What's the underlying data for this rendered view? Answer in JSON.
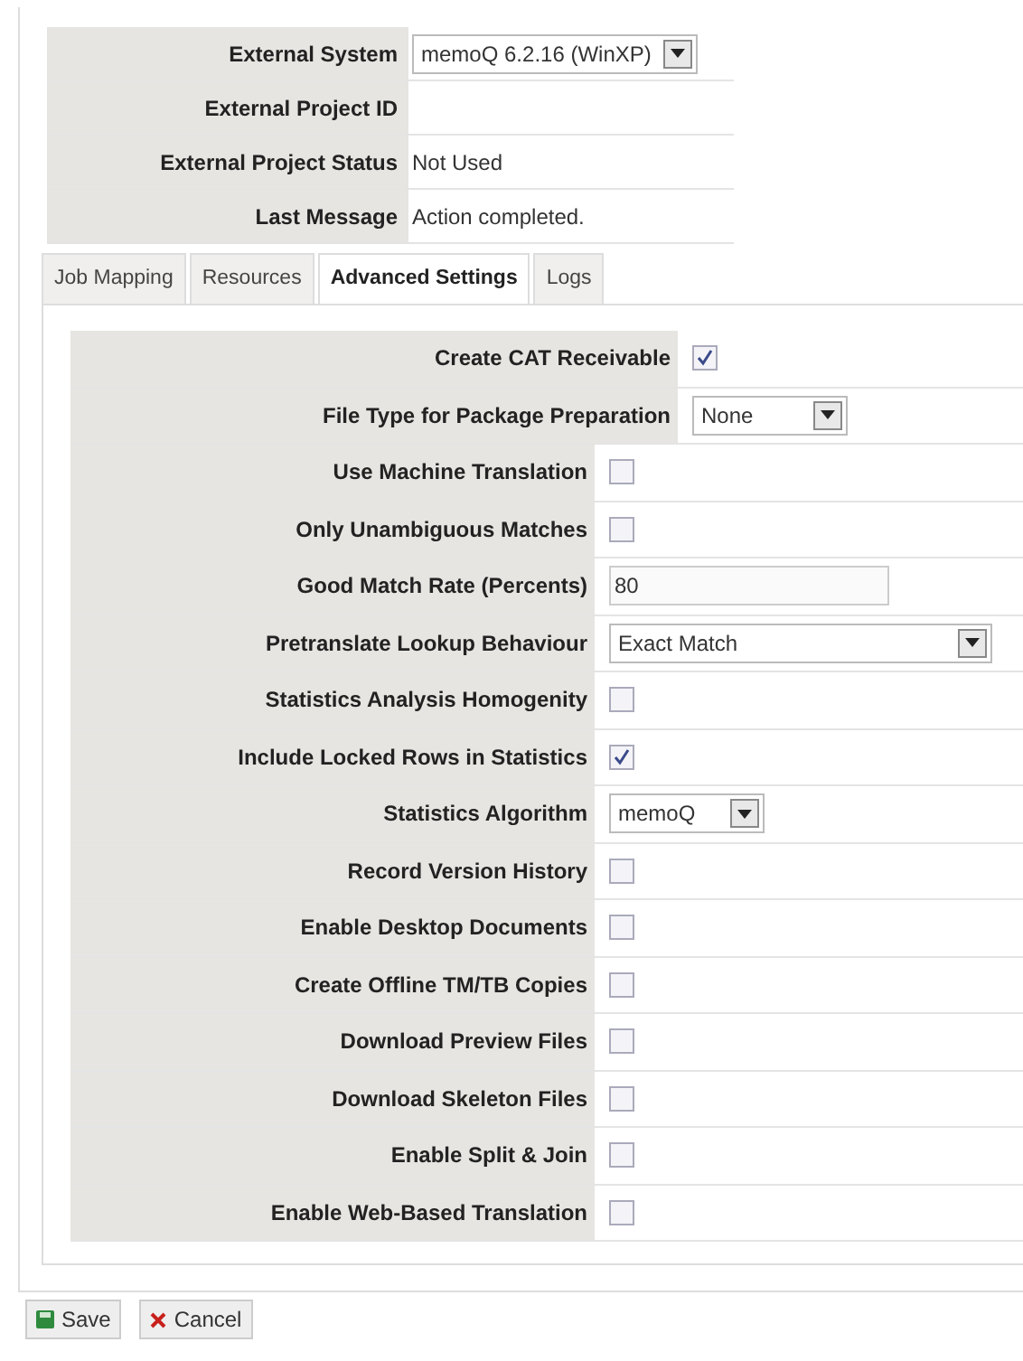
{
  "project": [
    {
      "label": "External System",
      "kind": "select",
      "value": "memoQ 6.2.16 (WinXP)"
    },
    {
      "label": "External Project ID",
      "kind": "text"
    },
    {
      "label": "External Project Status",
      "kind": "text",
      "value": "Not Used"
    },
    {
      "label": "Last Message",
      "kind": "text",
      "value": "Action completed."
    }
  ],
  "tabs": [
    {
      "label": "Job Mapping",
      "selected": false
    },
    {
      "label": "Resources",
      "selected": false
    },
    {
      "label": "Advanced Settings",
      "selected": true
    },
    {
      "label": "Logs",
      "selected": false
    }
  ],
  "settings": [
    {
      "label": "Create CAT Receivable",
      "kind": "checkbox",
      "checked": true,
      "wide": true
    },
    {
      "label": "File Type for Package Preparation",
      "kind": "select",
      "value": "None",
      "wide": true
    },
    {
      "label": "Use Machine Translation",
      "kind": "checkbox",
      "checked": false
    },
    {
      "label": "Only Unambiguous Matches",
      "kind": "checkbox",
      "checked": false
    },
    {
      "label": "Good Match Rate (Percents)",
      "kind": "input",
      "value": "80"
    },
    {
      "label": "Pretranslate Lookup Behaviour",
      "kind": "select",
      "value": "Exact Match"
    },
    {
      "label": "Statistics Analysis Homogenity",
      "kind": "checkbox",
      "checked": false
    },
    {
      "label": "Include Locked Rows in Statistics",
      "kind": "checkbox",
      "checked": true
    },
    {
      "label": "Statistics Algorithm",
      "kind": "select",
      "value": "memoQ"
    },
    {
      "label": "Record Version History",
      "kind": "checkbox",
      "checked": false
    },
    {
      "label": "Enable Desktop Documents",
      "kind": "checkbox",
      "checked": false
    },
    {
      "label": "Create Offline TM/TB Copies",
      "kind": "checkbox",
      "checked": false
    },
    {
      "label": "Download Preview Files",
      "kind": "checkbox",
      "checked": false
    },
    {
      "label": "Download Skeleton Files",
      "kind": "checkbox",
      "checked": false
    },
    {
      "label": "Enable Split & Join",
      "kind": "checkbox",
      "checked": false
    },
    {
      "label": "Enable Web-Based Translation",
      "kind": "checkbox",
      "checked": false
    }
  ],
  "buttons": [
    {
      "label": "Save",
      "kind": "save"
    },
    {
      "label": "Cancel",
      "kind": "cancel"
    }
  ]
}
